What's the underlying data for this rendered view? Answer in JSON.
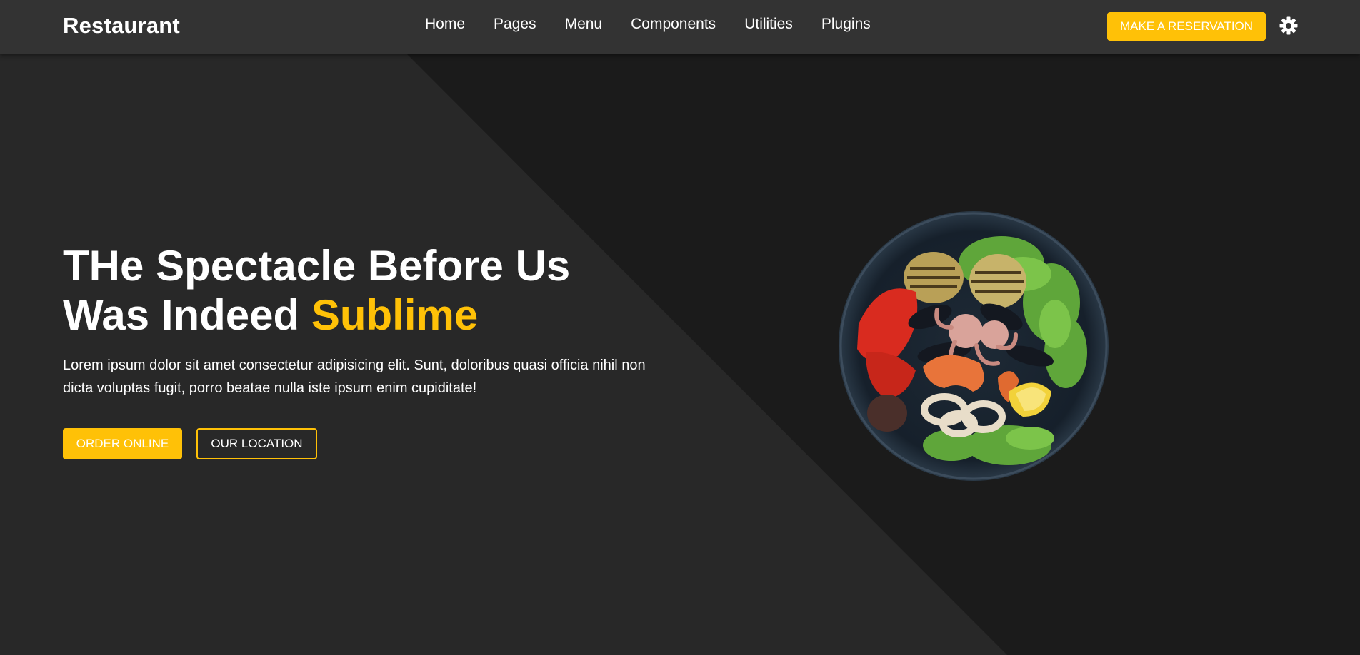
{
  "navbar": {
    "brand": "Restaurant",
    "links": [
      "Home",
      "Pages",
      "Menu",
      "Components",
      "Utilities",
      "Plugins"
    ],
    "reserve_label": "MAKE A RESERVATION",
    "theme_icon": "gear-icon"
  },
  "hero": {
    "title_line1": "THe Spectacle Before Us",
    "title_line2_prefix": "Was Indeed ",
    "title_accent": "Sublime",
    "description": "Lorem ipsum dolor sit amet consectetur adipisicing elit. Sunt, doloribus quasi officia nihil non dicta voluptas fugit, porro beatae nulla iste ipsum enim cupiditate!",
    "order_label": "ORDER ONLINE",
    "location_label": "OUR LOCATION",
    "image": "seafood-plate-image"
  },
  "colors": {
    "accent": "#ffc107",
    "navbar_bg": "#333333",
    "hero_bg_dark": "#1b1b1b",
    "hero_bg_light": "#282828",
    "text": "#ffffff"
  }
}
